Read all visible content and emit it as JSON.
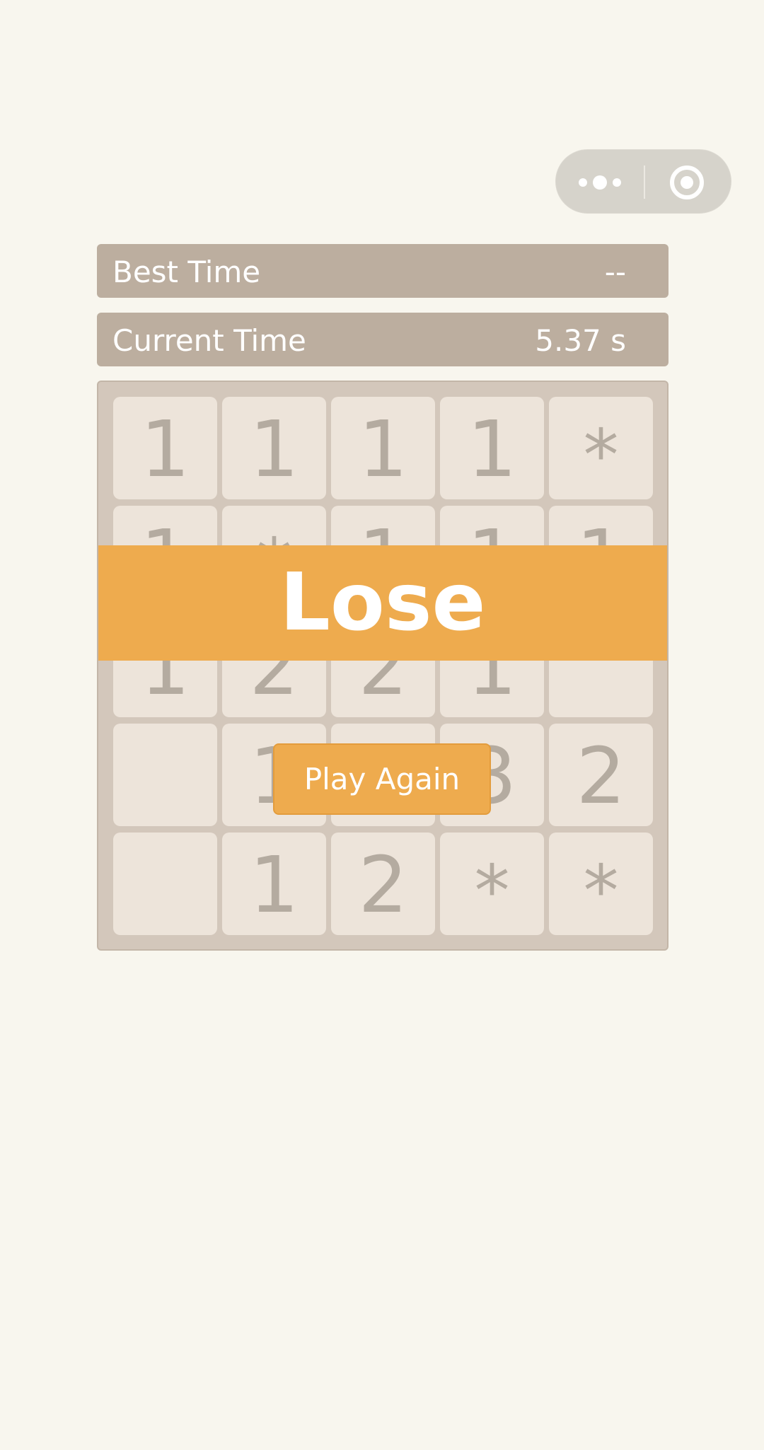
{
  "capsule": {
    "more_icon": "more-dots-icon",
    "close_icon": "target-close-icon"
  },
  "best_time": {
    "label": "Best Time",
    "value": "--"
  },
  "current_time": {
    "label": "Current Time",
    "value": "5.37 s"
  },
  "board": {
    "rows": 5,
    "cols": 5,
    "cells": [
      [
        "1",
        "1",
        "1",
        "1",
        "*"
      ],
      [
        "1",
        "*",
        "1",
        "1",
        "1"
      ],
      [
        "1",
        "2",
        "2",
        "1",
        ""
      ],
      [
        "",
        "1",
        "",
        "3",
        "2"
      ],
      [
        "",
        "1",
        "2",
        "*",
        "*"
      ]
    ]
  },
  "result": {
    "text": "Lose"
  },
  "play_again": {
    "label": "Play Again"
  },
  "colors": {
    "background": "#f8f6ee",
    "bar": "#bcae9f",
    "board": "#d3c7bb",
    "cell": "#ede4da",
    "cell_text": "#b4aba0",
    "accent": "#eeab4e"
  }
}
